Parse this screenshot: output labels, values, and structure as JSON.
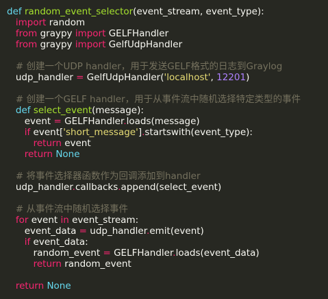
{
  "lines": [
    [
      {
        "t": "def",
        "c": "cst"
      },
      {
        "t": " ",
        "c": "plain"
      },
      {
        "t": "random_event_selector",
        "c": "fn"
      },
      {
        "t": "(event_stream, event_type):",
        "c": "plain"
      }
    ],
    [
      {
        "t": "   ",
        "c": "plain"
      },
      {
        "t": "import",
        "c": "kw"
      },
      {
        "t": " random",
        "c": "plain"
      }
    ],
    [
      {
        "t": "   ",
        "c": "plain"
      },
      {
        "t": "from",
        "c": "kw"
      },
      {
        "t": " graypy ",
        "c": "plain"
      },
      {
        "t": "import",
        "c": "kw"
      },
      {
        "t": " GELFHandler",
        "c": "plain"
      }
    ],
    [
      {
        "t": "   ",
        "c": "plain"
      },
      {
        "t": "from",
        "c": "kw"
      },
      {
        "t": " graypy ",
        "c": "plain"
      },
      {
        "t": "import",
        "c": "kw"
      },
      {
        "t": " GelfUdpHandler",
        "c": "plain"
      }
    ],
    [],
    [
      {
        "t": "   ",
        "c": "plain"
      },
      {
        "t": "# 创建一个UDP handler，用于发送GELF格式的日志到Graylog",
        "c": "cm"
      }
    ],
    [
      {
        "t": "   udp_handler ",
        "c": "plain"
      },
      {
        "t": "=",
        "c": "kw"
      },
      {
        "t": " GelfUdpHandler(",
        "c": "plain"
      },
      {
        "t": "'localhost'",
        "c": "str"
      },
      {
        "t": ", ",
        "c": "plain"
      },
      {
        "t": "12201",
        "c": "num"
      },
      {
        "t": ")",
        "c": "plain"
      }
    ],
    [],
    [
      {
        "t": "   ",
        "c": "plain"
      },
      {
        "t": "# 创建一个GELF handler，用于从事件流中随机选择特定类型的事件",
        "c": "cm"
      }
    ],
    [
      {
        "t": "   ",
        "c": "plain"
      },
      {
        "t": "def",
        "c": "cst"
      },
      {
        "t": " ",
        "c": "plain"
      },
      {
        "t": "select_event",
        "c": "fn"
      },
      {
        "t": "(message):",
        "c": "plain"
      }
    ],
    [
      {
        "t": "      event ",
        "c": "plain"
      },
      {
        "t": "=",
        "c": "kw"
      },
      {
        "t": " GELFHandler",
        "c": "plain"
      },
      {
        "t": ".",
        "c": "kw"
      },
      {
        "t": "loads(message)",
        "c": "plain"
      }
    ],
    [
      {
        "t": "      ",
        "c": "plain"
      },
      {
        "t": "if",
        "c": "kw"
      },
      {
        "t": " event[",
        "c": "plain"
      },
      {
        "t": "'short_message'",
        "c": "str"
      },
      {
        "t": "]",
        "c": "plain"
      },
      {
        "t": ".",
        "c": "kw"
      },
      {
        "t": "startswith(event_type):",
        "c": "plain"
      }
    ],
    [
      {
        "t": "         ",
        "c": "plain"
      },
      {
        "t": "return",
        "c": "kw"
      },
      {
        "t": " event",
        "c": "plain"
      }
    ],
    [
      {
        "t": "      ",
        "c": "plain"
      },
      {
        "t": "return",
        "c": "kw"
      },
      {
        "t": " ",
        "c": "plain"
      },
      {
        "t": "None",
        "c": "cst"
      }
    ],
    [],
    [
      {
        "t": "   ",
        "c": "plain"
      },
      {
        "t": "# 将事件选择器函数作为回调添加到handler",
        "c": "cm"
      }
    ],
    [
      {
        "t": "   udp_handler",
        "c": "plain"
      },
      {
        "t": ".",
        "c": "kw"
      },
      {
        "t": "callbacks",
        "c": "plain"
      },
      {
        "t": ".",
        "c": "kw"
      },
      {
        "t": "append(select_event)",
        "c": "plain"
      }
    ],
    [],
    [
      {
        "t": "   ",
        "c": "plain"
      },
      {
        "t": "# 从事件流中随机选择事件",
        "c": "cm"
      }
    ],
    [
      {
        "t": "   ",
        "c": "plain"
      },
      {
        "t": "for",
        "c": "kw"
      },
      {
        "t": " event ",
        "c": "plain"
      },
      {
        "t": "in",
        "c": "kw"
      },
      {
        "t": " event_stream:",
        "c": "plain"
      }
    ],
    [
      {
        "t": "      event_data ",
        "c": "plain"
      },
      {
        "t": "=",
        "c": "kw"
      },
      {
        "t": " udp_handler",
        "c": "plain"
      },
      {
        "t": ".",
        "c": "kw"
      },
      {
        "t": "emit(event)",
        "c": "plain"
      }
    ],
    [
      {
        "t": "      ",
        "c": "plain"
      },
      {
        "t": "if",
        "c": "kw"
      },
      {
        "t": " event_data:",
        "c": "plain"
      }
    ],
    [
      {
        "t": "         random_event ",
        "c": "plain"
      },
      {
        "t": "=",
        "c": "kw"
      },
      {
        "t": " GELFHandler",
        "c": "plain"
      },
      {
        "t": ".",
        "c": "kw"
      },
      {
        "t": "loads(event_data)",
        "c": "plain"
      }
    ],
    [
      {
        "t": "         ",
        "c": "plain"
      },
      {
        "t": "return",
        "c": "kw"
      },
      {
        "t": " random_event",
        "c": "plain"
      }
    ],
    [],
    [
      {
        "t": "   ",
        "c": "plain"
      },
      {
        "t": "return",
        "c": "kw"
      },
      {
        "t": " ",
        "c": "plain"
      },
      {
        "t": "None",
        "c": "cst"
      }
    ]
  ]
}
